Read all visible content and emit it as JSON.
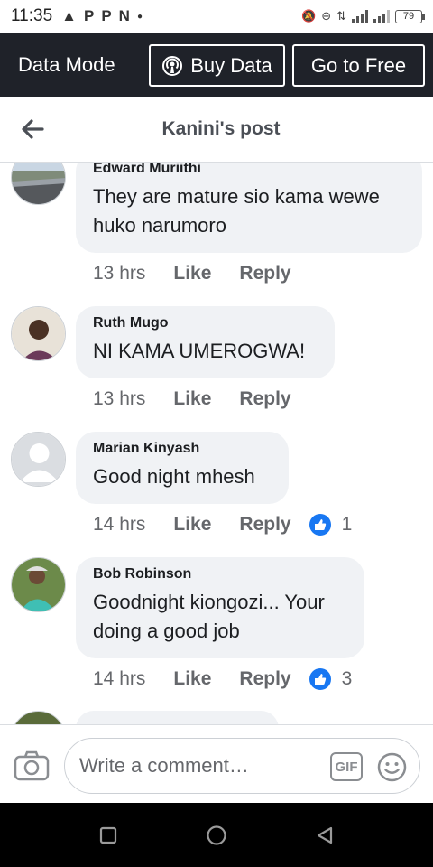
{
  "status_bar": {
    "time": "11:35",
    "battery": "79"
  },
  "banner": {
    "data_mode_label": "Data Mode",
    "buy_data_label": "Buy Data",
    "go_to_free_label": "Go to Free"
  },
  "header": {
    "title": "Kanini's post"
  },
  "comments": [
    {
      "author": "Edward Muriithi",
      "text": "They are mature sio kama wewe huko narumoro",
      "time": "13 hrs",
      "like_label": "Like",
      "reply_label": "Reply",
      "reactions": null
    },
    {
      "author": "Ruth Mugo",
      "text": "NI KAMA UMEROGWA!",
      "time": "13 hrs",
      "like_label": "Like",
      "reply_label": "Reply",
      "reactions": null
    },
    {
      "author": "Marian Kinyash",
      "text": "Good night mhesh",
      "time": "14 hrs",
      "like_label": "Like",
      "reply_label": "Reply",
      "reactions": "1"
    },
    {
      "author": "Bob Robinson",
      "text": "Goodnight kiongozi... Your doing a good job",
      "time": "14 hrs",
      "like_label": "Like",
      "reply_label": "Reply",
      "reactions": "3"
    }
  ],
  "composer": {
    "placeholder": "Write a comment…",
    "gif_label": "GIF"
  },
  "colors": {
    "banner_bg": "#1f2229",
    "bubble_bg": "#f0f2f5",
    "like_blue": "#1877f2",
    "meta_gray": "#65676b"
  }
}
